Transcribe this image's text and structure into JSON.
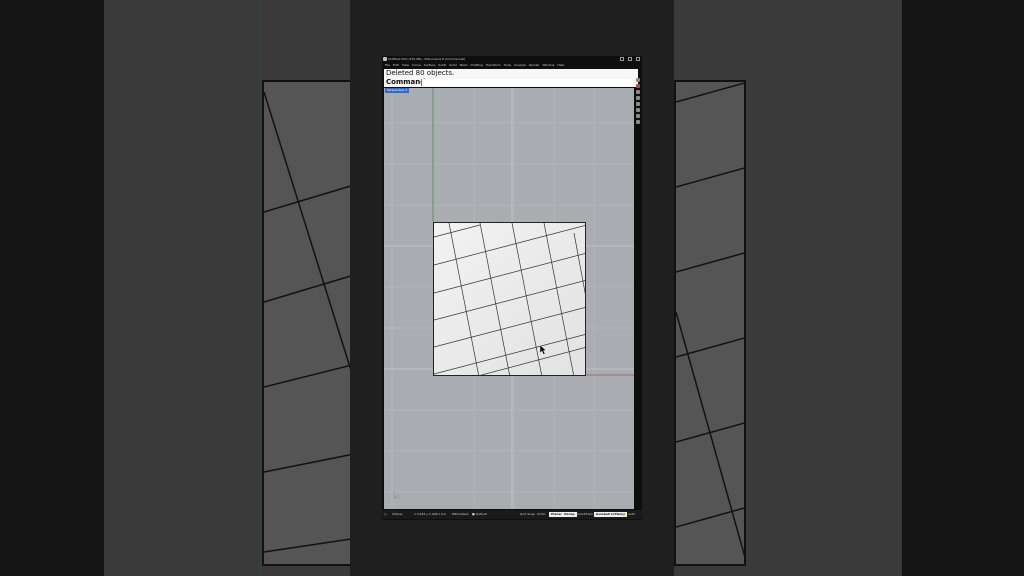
{
  "window": {
    "title": "Untitled.3dm (331 KB) - Rhinoceros 8 (Commercial)"
  },
  "menu": [
    "File",
    "Edit",
    "View",
    "Curve",
    "Surface",
    "SubD",
    "Solid",
    "Mesh",
    "Drafting",
    "Transform",
    "Tools",
    "Analyze",
    "Render",
    "Window",
    "Help"
  ],
  "command": {
    "history": "Deleted 80 objects.",
    "prompt": "Command:"
  },
  "viewport": {
    "tab": "Perspective"
  },
  "statusbar": {
    "cplane": "CPlane",
    "coords": "x 3.634  y 1.028  z 0.0",
    "units": "Millimeters",
    "layer": "Default",
    "toggles": [
      {
        "label": "Grid Snap",
        "on": false
      },
      {
        "label": "Ortho",
        "on": false
      },
      {
        "label": "Planar",
        "on": true
      },
      {
        "label": "Osnap",
        "on": true
      },
      {
        "label": "SmartTrack",
        "on": false
      },
      {
        "label": "Gumball (CPlane)",
        "on": true
      }
    ],
    "lock": "Auto"
  },
  "colors": {
    "viewport_bg": "#a9adb2",
    "tab_blue": "#2d6bd2",
    "surface": "#ececec"
  }
}
